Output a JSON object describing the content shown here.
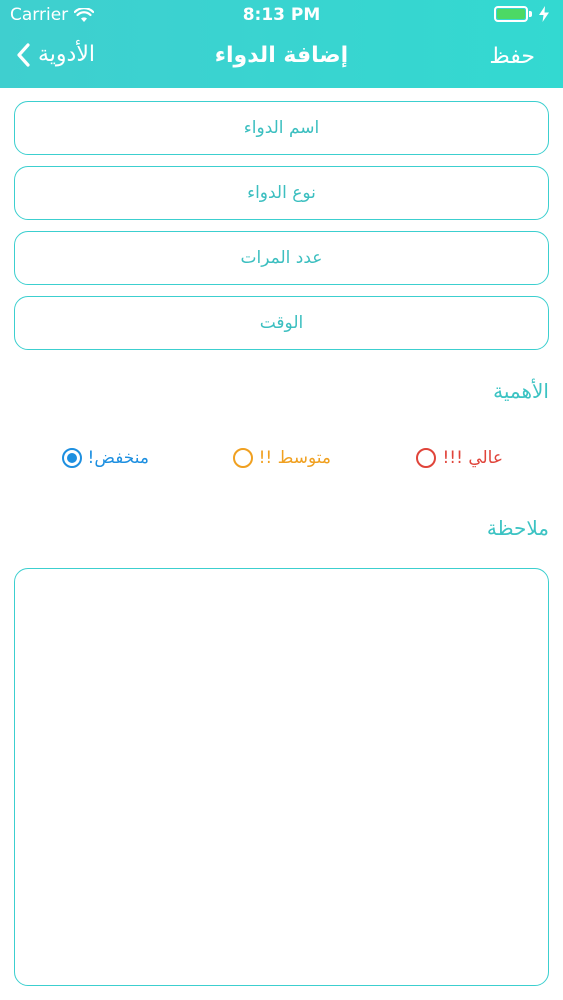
{
  "status_bar": {
    "carrier": "Carrier",
    "time": "8:13 PM"
  },
  "nav": {
    "save_label": "حفظ",
    "title": "إضافة الدواء",
    "back_label": "الأدوية"
  },
  "form": {
    "fields": [
      {
        "placeholder": "اسم الدواء"
      },
      {
        "placeholder": "نوع الدواء"
      },
      {
        "placeholder": "عدد المرات"
      },
      {
        "placeholder": "الوقت"
      }
    ],
    "importance_label": "الأهمية",
    "importance_options": [
      {
        "label": "عالي !!!",
        "color": "#e0443a",
        "selected": false
      },
      {
        "label": "متوسط !!",
        "color": "#f0a020",
        "selected": false
      },
      {
        "label": "منخفض!",
        "color": "#1d8fe0",
        "selected": true
      }
    ],
    "note_label": "ملاحظة",
    "note_value": ""
  },
  "colors": {
    "header_gradient_start": "#3fcfcf",
    "header_gradient_end": "#33d9d1",
    "accent": "#3ccfcf",
    "text_accent": "#3cbfc0",
    "battery": "#4cd964"
  }
}
